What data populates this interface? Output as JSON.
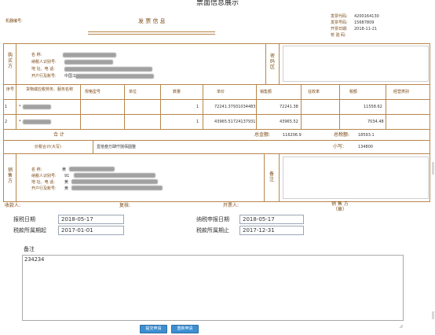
{
  "window": {
    "title": "票面信息展示"
  },
  "header": {
    "machine_no_label": "机器编号:",
    "invoice_title": "发 票 信 息",
    "code_label": "发票代码:",
    "code_value": "4200164130",
    "number_label": "发票号码:",
    "number_value": "15687809",
    "date_label": "开票日期:",
    "date_value": "2018-11-21",
    "check_label": "校 验 码:"
  },
  "buyer": {
    "side_label": "购\n买\n方",
    "name_label": "名    称:",
    "taxid_label": "纳税人识别号:",
    "address_label": "地 址、电 话:",
    "bank_label": "开户行及账号:",
    "bank_value": "中国工",
    "cipher_label": "密\n码\n区"
  },
  "items": {
    "headers": [
      "序号",
      "货物或应税劳务、服务名称",
      "规格型号",
      "单位",
      "数量",
      "单价",
      "销售额",
      "征收率",
      "税额",
      "经营类别"
    ],
    "rows": [
      {
        "index": "1",
        "name": "*",
        "qty": "1",
        "unit_price": "72241.37931034483",
        "amount": "72241.38",
        "tax": "11558.62"
      },
      {
        "index": "2",
        "name": "*",
        "qty": "1",
        "unit_price": "43965.51724137931",
        "amount": "43965.52",
        "tax": "7034.48"
      }
    ]
  },
  "totals": {
    "total_label": "合 计",
    "total_amount_label": "总金额:",
    "total_amount": "116206.9",
    "total_tax_label": "总税额:",
    "total_tax": "18593.1",
    "grand_label": "价税合计(大写)",
    "grand_upper": "壹拾叁万肆仟捌佰圆整",
    "small_label": "小写:",
    "small_value": "134800"
  },
  "seller": {
    "side_label": "销\n售\n方",
    "name_label": "名    称:",
    "name_value": "黄",
    "taxid_label": "纳税人识别号:",
    "taxid_value": "91",
    "address_label": "地 址、电 话:",
    "address_value": "黄",
    "bank_label": "开户行及账号:",
    "bank_value": "黄",
    "remark_label": "备\n注"
  },
  "signatures": {
    "payee": "收款人:",
    "reviewer": "复核:",
    "drawer": "开票人:",
    "seller_stamp": "销 售 方\n（章）"
  },
  "form": {
    "report_date_label": "报税日期",
    "report_date": "2018-05-17",
    "declare_date_label": "纳税申报日期",
    "declare_date": "2018-05-17",
    "period_start_label": "税款所属期起",
    "period_start": "2017-01-01",
    "period_end_label": "税款所属期止",
    "period_end": "2017-12-31",
    "remark_label": "备注",
    "remark_value": "234234"
  },
  "buttons": {
    "submit": "提交申请",
    "reset": "重新申请"
  },
  "colors": {
    "border": "#b8864b",
    "button": "#3d8fd1",
    "heading": "#7a4a14"
  }
}
